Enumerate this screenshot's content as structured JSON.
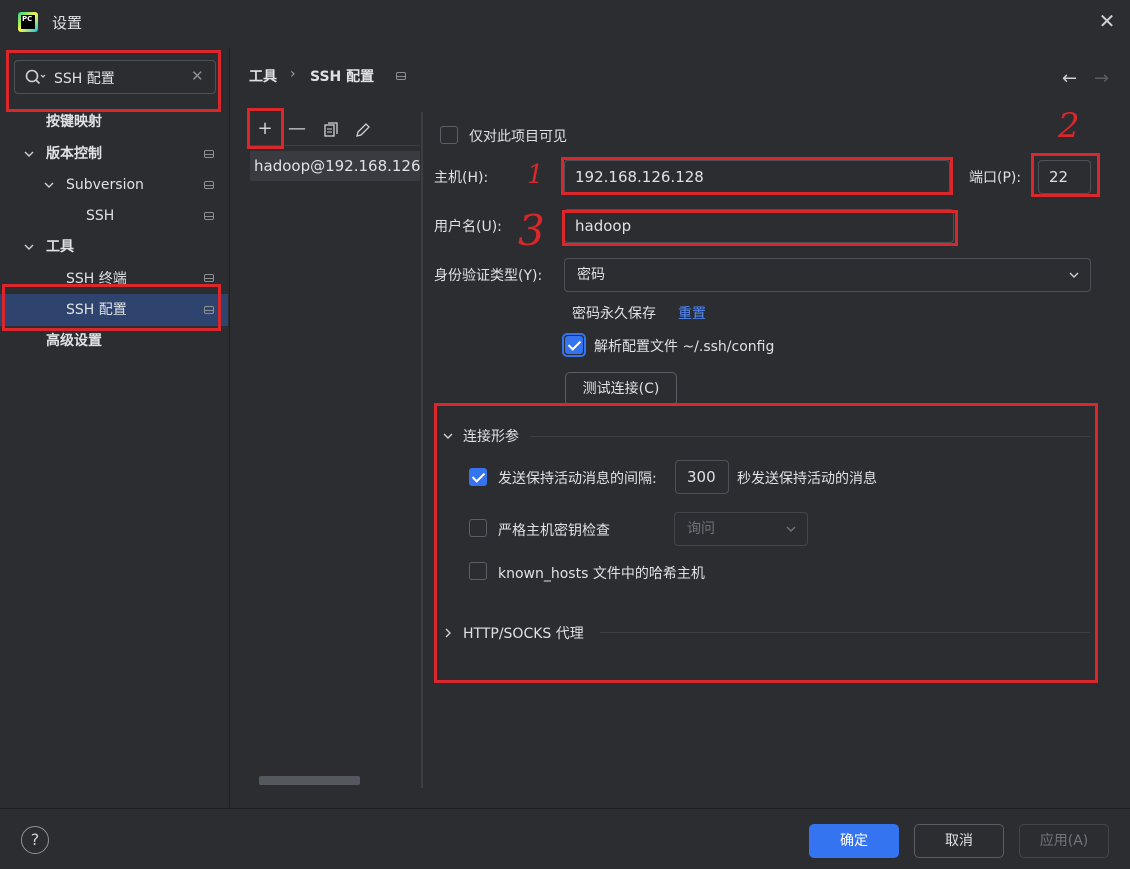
{
  "window": {
    "title": "设置"
  },
  "search": {
    "value": "SSH 配置"
  },
  "sidebar": {
    "items": [
      {
        "label": "按键映射"
      },
      {
        "label": "版本控制"
      },
      {
        "label": "Subversion"
      },
      {
        "label": "SSH"
      },
      {
        "label": "工具"
      },
      {
        "label": "SSH 终端"
      },
      {
        "label": "SSH 配置"
      },
      {
        "label": "高级设置"
      }
    ]
  },
  "breadcrumb": {
    "parent": "工具",
    "separator": "›",
    "current": "SSH 配置"
  },
  "list": {
    "items": [
      "hadoop@192.168.126."
    ]
  },
  "form": {
    "project_only_label": "仅对此项目可见",
    "host_label": "主机(H):",
    "host_value": "192.168.126.128",
    "port_label": "端口(P):",
    "port_value": "22",
    "user_label": "用户名(U):",
    "user_value": "hadoop",
    "auth_label": "身份验证类型(Y):",
    "auth_value": "密码",
    "password_saved": "密码永久保存",
    "reset_link": "重置",
    "parse_config_label": "解析配置文件 ~/.ssh/config",
    "test_button": "测试连接(C)"
  },
  "connection": {
    "section_title": "连接形参",
    "keepalive_label": "发送保持活动消息的间隔:",
    "keepalive_value": "300",
    "keepalive_suffix": "秒发送保持活动的消息",
    "strict_label": "严格主机密钥检查",
    "strict_value": "询问",
    "hash_label": "known_hosts 文件中的哈希主机"
  },
  "proxy": {
    "section_title": "HTTP/SOCKS 代理"
  },
  "annotations": [
    "1",
    "2",
    "3"
  ],
  "footer": {
    "ok": "确定",
    "cancel": "取消",
    "apply": "应用(A)",
    "help": "?"
  },
  "colors": {
    "accent": "#3574f0",
    "annotation": "#d9272b",
    "background": "#2b2d30",
    "selection": "#2e436e"
  }
}
